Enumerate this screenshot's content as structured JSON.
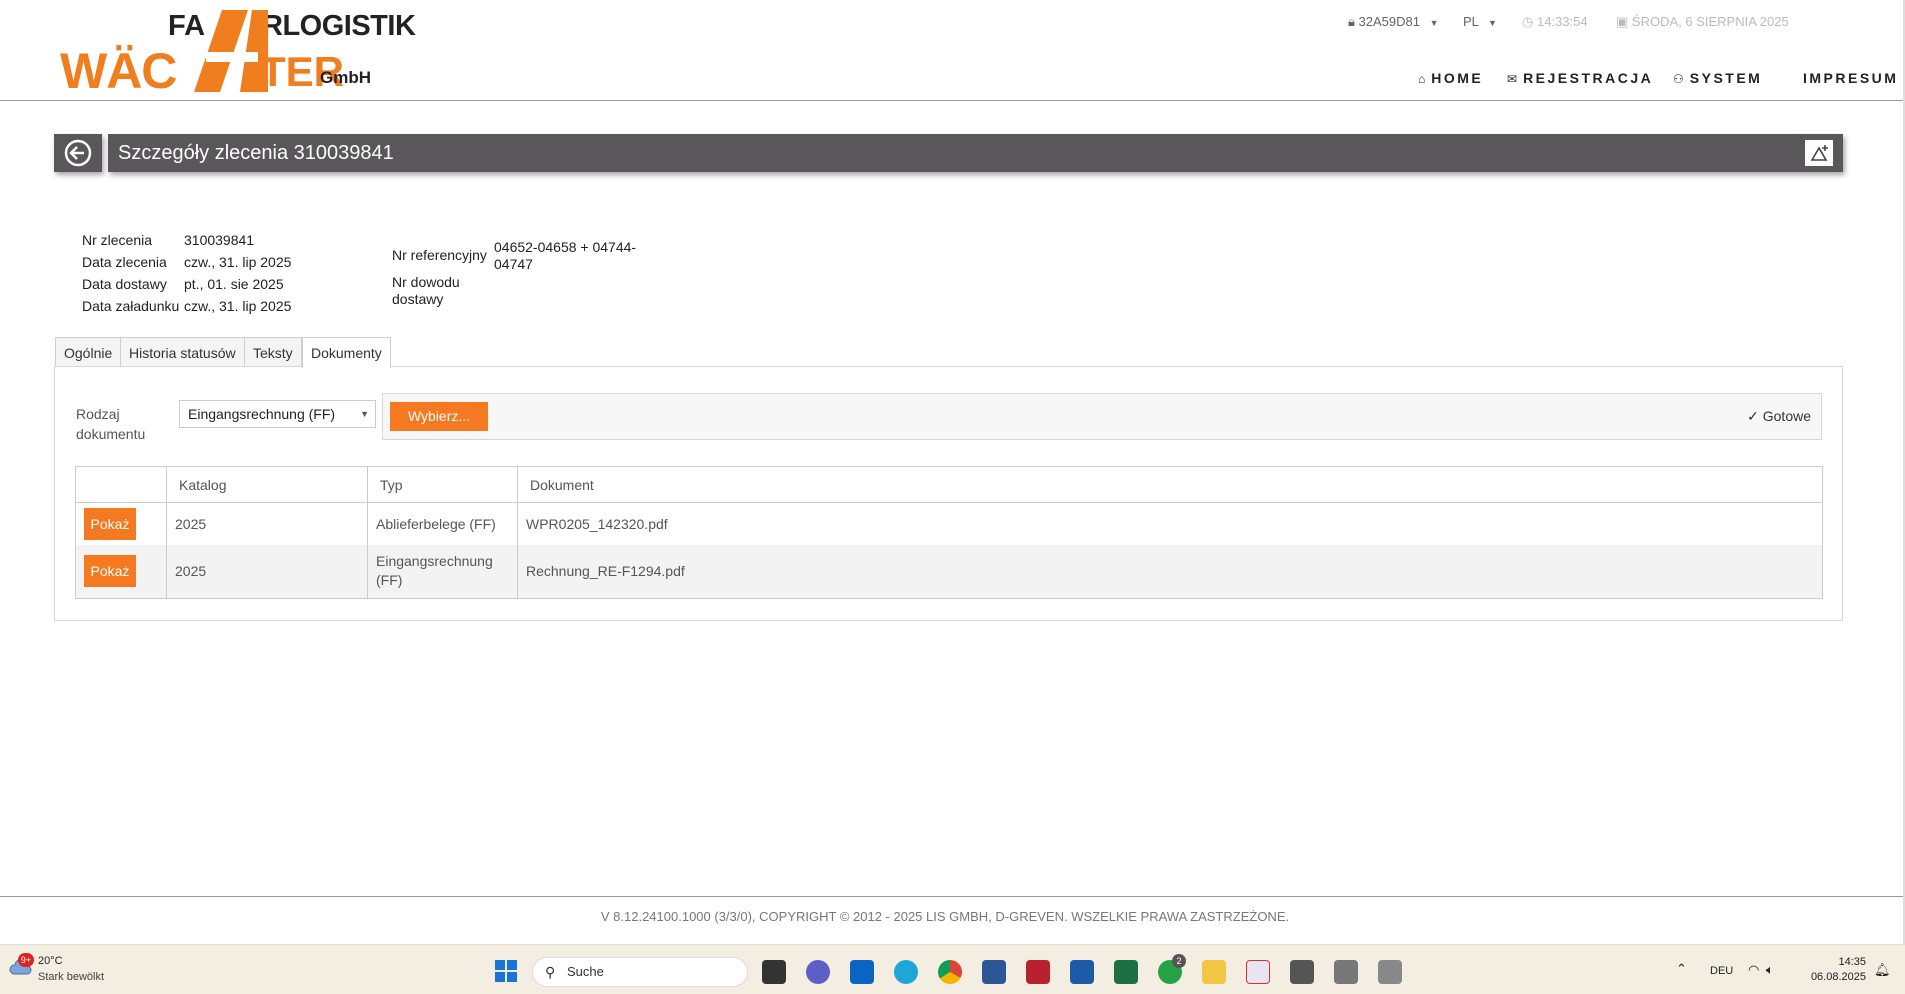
{
  "header": {
    "logo": {
      "line1a": "FA",
      "line1b": "RLOGISTIK",
      "line2a": "WÄC",
      "line2b": "TER",
      "suffix": "GmbH"
    },
    "session_id": "32A59D81",
    "language": "PL",
    "time": "14:33:54",
    "date": "ŚRODA, 6 SIERPNIA 2025",
    "nav": [
      "HOME",
      "REJESTRACJA",
      "SYSTEM",
      "IMPRESUM"
    ]
  },
  "page": {
    "title": "Szczegóły zlecenia 310039841"
  },
  "order_info": {
    "nr_zlecenia_label": "Nr zlecenia",
    "nr_zlecenia": "310039841",
    "data_zlecenia_label": "Data zlecenia",
    "data_zlecenia": "czw., 31. lip 2025",
    "data_dostawy_label": "Data dostawy",
    "data_dostawy": "pt., 01. sie 2025",
    "data_zaladunku_label": "Data załadunku",
    "data_zaladunku": "czw., 31. lip 2025",
    "nr_ref_label": "Nr referencyjny",
    "nr_ref_line1": "04652-04658 + 04744-",
    "nr_ref_line2": "04747",
    "nr_dowodu_label_1": "Nr dowodu",
    "nr_dowodu_label_2": "dostawy"
  },
  "tabs": [
    "Ogólnie",
    "Historia statusów",
    "Teksty",
    "Dokumenty"
  ],
  "documents": {
    "doc_type_label_1": "Rodzaj",
    "doc_type_label_2": "dokumentu",
    "doc_type_selected": "Eingangsrechnung (FF)",
    "choose_button": "Wybierz...",
    "status": "Gotowe",
    "columns": [
      "",
      "Katalog",
      "Typ",
      "Dokument"
    ],
    "rows": [
      {
        "action": "Pokaż",
        "catalog": "2025",
        "type_1": "Ablieferbelege (FF)",
        "type_2": "",
        "document": "WPR0205_142320.pdf"
      },
      {
        "action": "Pokaż",
        "catalog": "2025",
        "type_1": "Eingangsrechnung",
        "type_2": "(FF)",
        "document": "Rechnung_RE-F1294.pdf"
      }
    ]
  },
  "footer": {
    "text": "V 8.12.24100.1000 (3/3/0), COPYRIGHT © 2012 - 2025 LIS GMBH, D-GREVEN. WSZELKIE PRAWA ZASTRZEŻONE."
  },
  "taskbar": {
    "weather_badge": "9+",
    "temperature": "20°C",
    "weather": "Stark bewölkt",
    "search_placeholder": "Suche",
    "whatsapp_badge": "2",
    "keyboard": "DEU",
    "clock_time": "14:35",
    "clock_date": "06.08.2025"
  },
  "colors": {
    "accent": "#f47920",
    "titlebar": "#5a575a"
  }
}
